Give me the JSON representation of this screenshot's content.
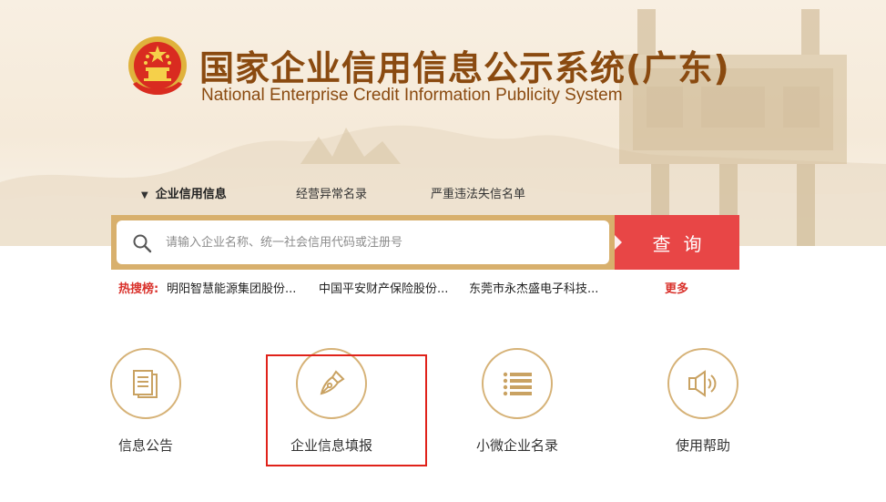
{
  "header": {
    "title_cn": "国家企业信用信息公示系统(广东)",
    "title_en": "National Enterprise Credit Information Publicity System"
  },
  "tabs": [
    {
      "label": "企业信用信息",
      "active": true
    },
    {
      "label": "经营异常名录",
      "active": false
    },
    {
      "label": "严重违法失信名单",
      "active": false
    }
  ],
  "search": {
    "placeholder": "请输入企业名称、统一社会信用代码或注册号",
    "button_label": "查询"
  },
  "hotlist": {
    "label": "热搜榜:",
    "items": [
      "明阳智慧能源集团股份...",
      "中国平安财产保险股份...",
      "东莞市永杰盛电子科技..."
    ],
    "more_label": "更多"
  },
  "features": [
    {
      "label": "信息公告",
      "icon": "document-icon"
    },
    {
      "label": "企业信息填报",
      "icon": "pen-nib-icon"
    },
    {
      "label": "小微企业名录",
      "icon": "list-icon"
    },
    {
      "label": "使用帮助",
      "icon": "speaker-icon"
    }
  ],
  "colors": {
    "brand_brown": "#8a4a10",
    "gold": "#d8b06d",
    "search_red": "#e84646",
    "hot_red": "#d9312b",
    "highlight_red": "#e0221a"
  }
}
